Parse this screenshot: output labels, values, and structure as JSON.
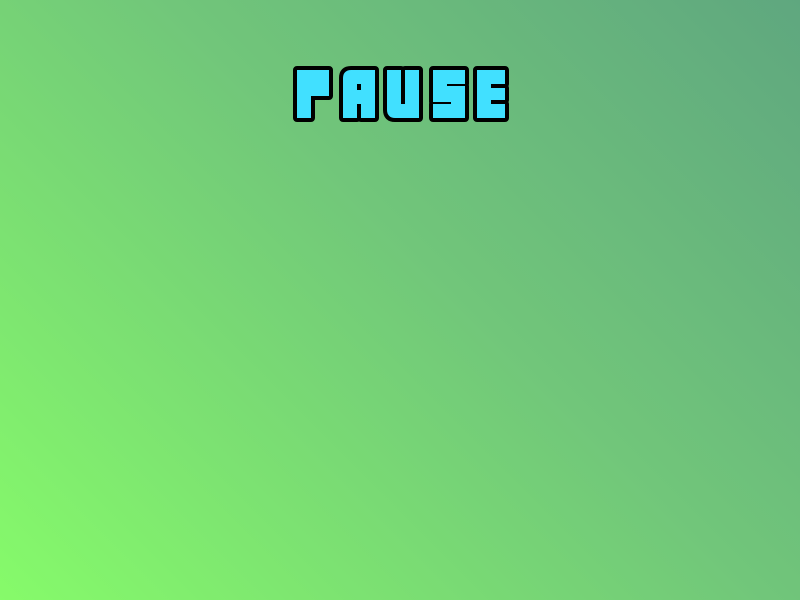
{
  "screen": {
    "title": "PAUSE",
    "title_color": "#41e0ff",
    "outline_color": "#000000",
    "background_gradient": [
      "#5fa77f",
      "#71c67a",
      "#86fb6a"
    ]
  }
}
